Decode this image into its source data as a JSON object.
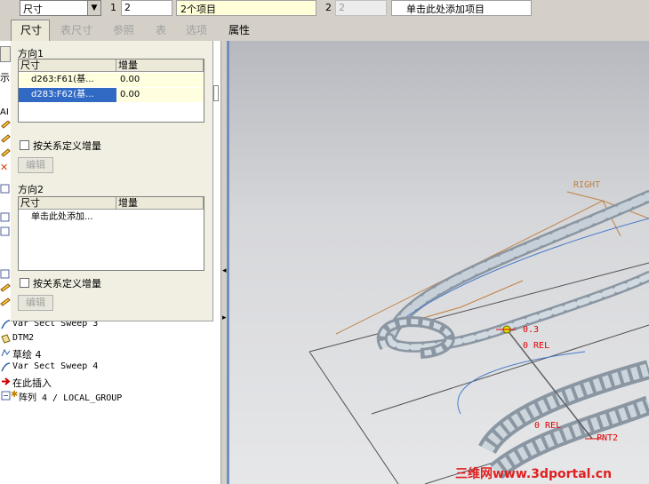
{
  "toolbar": {
    "type_select": "尺寸",
    "index1": "1",
    "field1": "2",
    "items_count": "2个项目",
    "index2": "2",
    "field2": "2",
    "add_item": "单击此处添加项目"
  },
  "tabs": [
    {
      "label": "尺寸",
      "active": true
    },
    {
      "label": "表尺寸",
      "active": false
    },
    {
      "label": "参照",
      "active": false
    },
    {
      "label": "表",
      "active": false
    },
    {
      "label": "选项",
      "active": false
    },
    {
      "label": "属性",
      "active": false
    }
  ],
  "panel": {
    "dir1_title": "方向1",
    "dir1_headers": [
      "尺寸",
      "增量"
    ],
    "dir1_rows": [
      {
        "dim": "d263:F61(基...",
        "inc": "0.00"
      },
      {
        "dim": "d283:F62(基...",
        "inc": "0.00"
      }
    ],
    "dir1_checkbox": "按关系定义增量",
    "dir1_edit": "编辑",
    "dir2_title": "方向2",
    "dir2_headers": [
      "尺寸",
      "增量"
    ],
    "dir2_add": "单击此处添加...",
    "dir2_checkbox": "按关系定义增量",
    "dir2_edit": "编辑"
  },
  "tree_fragments": {
    "show": "示",
    "ai": "AI"
  },
  "tree": [
    {
      "label": "Var Sect Sweep 3",
      "icon": "sweep-icon"
    },
    {
      "label": "DTM2",
      "icon": "datum-plane-icon"
    },
    {
      "label": "草绘 4",
      "icon": "sketch-icon"
    },
    {
      "label": "Var Sect Sweep 4",
      "icon": "sweep-icon"
    },
    {
      "label": "在此插入",
      "icon": "insert-arrow-icon"
    },
    {
      "label": "阵列 4 / LOCAL_GROUP",
      "icon": "pattern-icon"
    }
  ],
  "viewport": {
    "right_label": "RIGHT",
    "dim_label": "0.3",
    "rel1": "0 REL",
    "rel2": "0 REL",
    "pnt": "PNT2",
    "watermark": "三维网www.3dportal.cn",
    "colors": {
      "cable": "#b9c3cc",
      "datum": "#c08040",
      "dim": "#e00000",
      "watermark": "#e02020"
    }
  }
}
